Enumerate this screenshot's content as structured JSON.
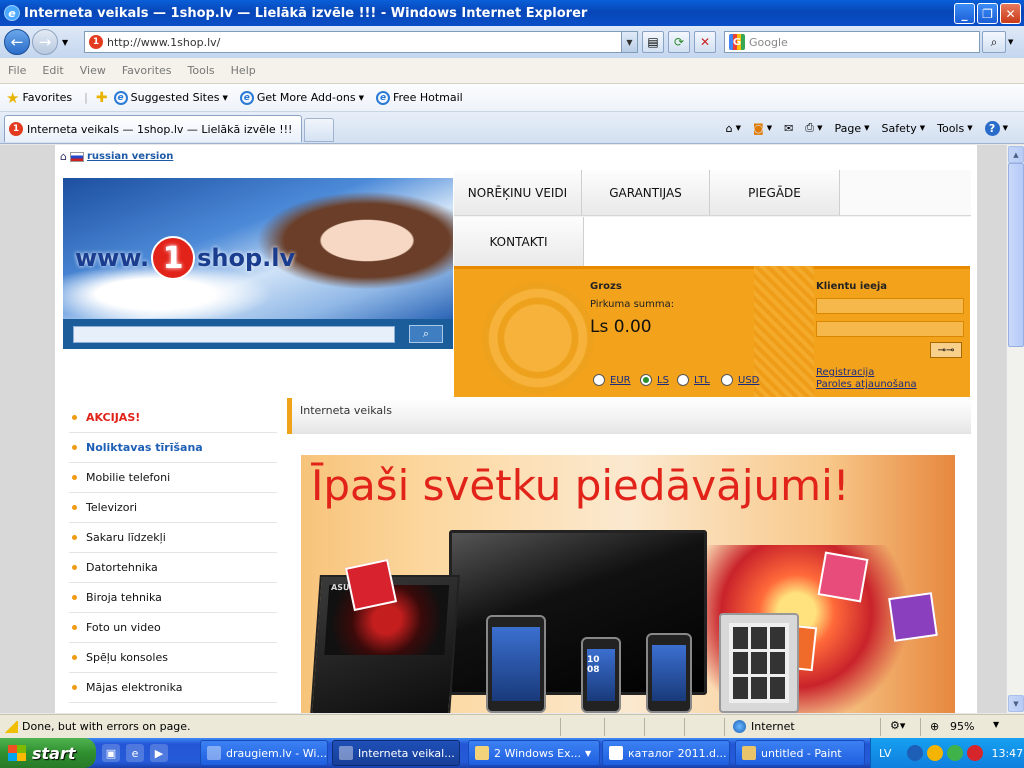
{
  "window": {
    "title": "Interneta veikals — 1shop.lv — Lielākā izvēle !!! - Windows Internet Explorer"
  },
  "browser": {
    "address": "http://www.1shop.lv/",
    "search_placeholder": "Google",
    "menu": [
      "File",
      "Edit",
      "View",
      "Favorites",
      "Tools",
      "Help"
    ],
    "favorites_label": "Favorites",
    "fav_links": [
      "Suggested Sites",
      "Get More Add-ons",
      "Free Hotmail"
    ],
    "tab_title": "Interneta veikals — 1shop.lv — Lielākā izvēle !!!",
    "commands": [
      "Page",
      "Safety",
      "Tools"
    ]
  },
  "site": {
    "russian_link": "russian version",
    "logo": {
      "www": "www.",
      "one": "1",
      "shop": "shop.lv"
    },
    "nav_tabs": [
      "NORĒĶINU VEIDI",
      "GARANTIJAS",
      "PIEGĀDE",
      "KONTAKTI"
    ],
    "cart": {
      "title": "Grozs",
      "sum_label": "Pirkuma summa:",
      "sum": "Ls 0.00",
      "currencies": [
        "EUR",
        "LS",
        "LTL",
        "USD"
      ],
      "selected_currency": "LS"
    },
    "login": {
      "title": "Klientu ieeja",
      "register": "Registracija",
      "forgot": "Paroles atjaunošana"
    },
    "categories": [
      {
        "label": "AKCIJAS!",
        "style": "red"
      },
      {
        "label": "Noliktavas tīrīšana",
        "style": "blue"
      },
      {
        "label": "Mobilie telefoni",
        "style": "normal"
      },
      {
        "label": "Televizori",
        "style": "normal"
      },
      {
        "label": "Sakaru līdzekļi",
        "style": "normal"
      },
      {
        "label": "Datortehnika",
        "style": "normal"
      },
      {
        "label": "Biroja tehnika",
        "style": "normal"
      },
      {
        "label": "Foto un video",
        "style": "normal"
      },
      {
        "label": "Spēļu konsoles",
        "style": "normal"
      },
      {
        "label": "Mājas elektronika",
        "style": "normal"
      }
    ],
    "breadcrumb": "Interneta veikals",
    "promo": {
      "headline": "Īpaši svētku piedāvājumi!",
      "laptop_brand": "ASUS",
      "phone_time": "10 08"
    }
  },
  "status": {
    "text": "Done, but with errors on page.",
    "zone": "Internet",
    "zoom": "95%"
  },
  "taskbar": {
    "start": "start",
    "items": [
      "draugiem.lv - Wi...",
      "Interneta veikal...",
      "2 Windows Ex...",
      "каталог 2011.d...",
      "untitled - Paint"
    ],
    "active_index": 1,
    "lang": "LV",
    "clock": "13:47"
  }
}
